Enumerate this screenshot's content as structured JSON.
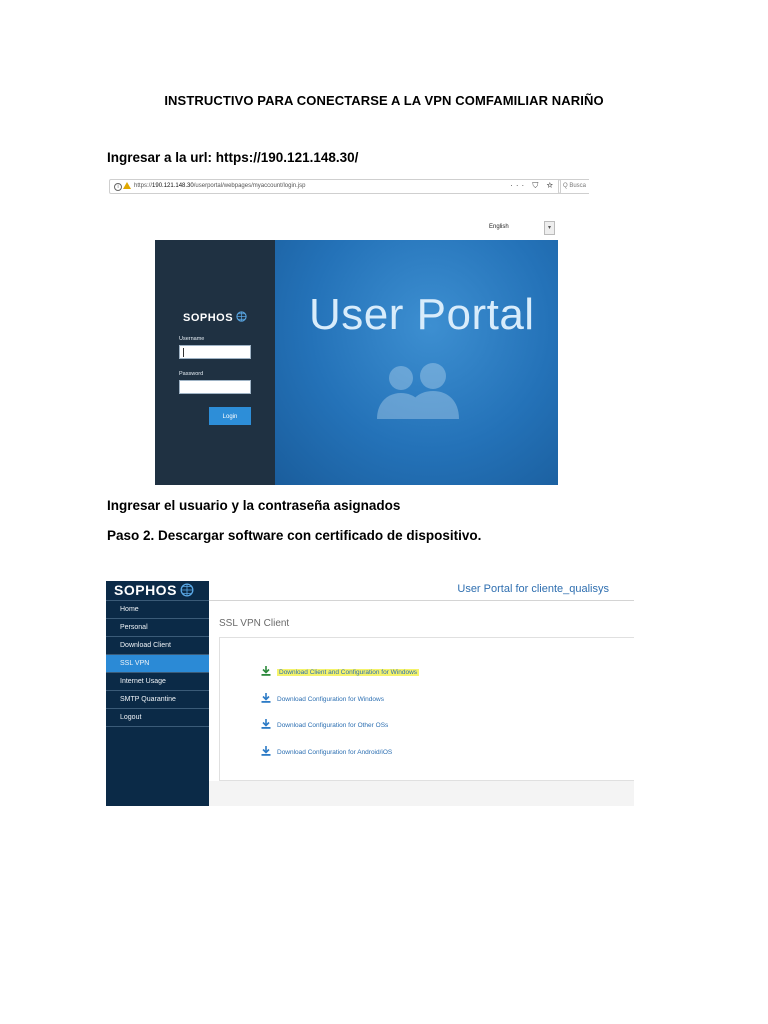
{
  "document": {
    "title": "INSTRUCTIVO PARA CONECTARSE A LA VPN COMFAMILIAR NARIÑO",
    "step1": "Ingresar a la url:  https://190.121.148.30/",
    "step2": "Ingresar el usuario y la contraseña asignados",
    "step3": "Paso 2. Descargar software con certificado de dispositivo."
  },
  "browser": {
    "url_prefix": "https://",
    "url_host": "190.121.148.30",
    "url_path": "/userportal/webpages/myaccount/login.jsp",
    "toolbar_icons": "··· ⛉ ☆",
    "search_placeholder": "Q  Busca"
  },
  "login": {
    "language": "English",
    "brand": "SOPHOS",
    "hero_title": "User Portal",
    "username_label": "Username",
    "password_label": "Password",
    "login_button": "Login"
  },
  "portal": {
    "brand": "SOPHOS",
    "header": "User Portal for cliente_qualisys",
    "section_title": "SSL VPN Client",
    "nav": [
      {
        "label": "Home",
        "active": false
      },
      {
        "label": "Personal",
        "active": false
      },
      {
        "label": "Download Client",
        "active": false
      },
      {
        "label": "SSL VPN",
        "active": true
      },
      {
        "label": "Internet Usage",
        "active": false
      },
      {
        "label": "SMTP Quarantine",
        "active": false
      },
      {
        "label": "Logout",
        "active": false
      }
    ],
    "downloads": [
      {
        "label": "Download Client and Configuration for Windows",
        "highlighted": true
      },
      {
        "label": "Download Configuration for Windows",
        "highlighted": false
      },
      {
        "label": "Download Configuration for Other OSs",
        "highlighted": false
      },
      {
        "label": "Download Configuration for Android/iOS",
        "highlighted": false
      }
    ],
    "accent_color": "#2b8ad6",
    "nav_color": "#0b2a47"
  }
}
